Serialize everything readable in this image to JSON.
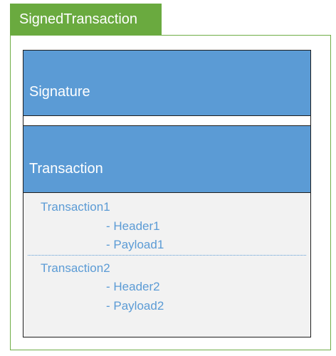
{
  "title": "SignedTransaction",
  "signature_label": "Signature",
  "transaction_label": "Transaction",
  "transactions": [
    {
      "name": "Transaction1",
      "header": "- Header1",
      "payload": "- Payload1"
    },
    {
      "name": "Transaction2",
      "header": "- Header2",
      "payload": "- Payload2"
    }
  ],
  "colors": {
    "title_bg": "#6aaa3f",
    "frame_border": "#70ad47",
    "band_blue": "#5b9bd5",
    "text_blue": "#5b9bd5",
    "panel_gray": "#f2f2f2"
  }
}
